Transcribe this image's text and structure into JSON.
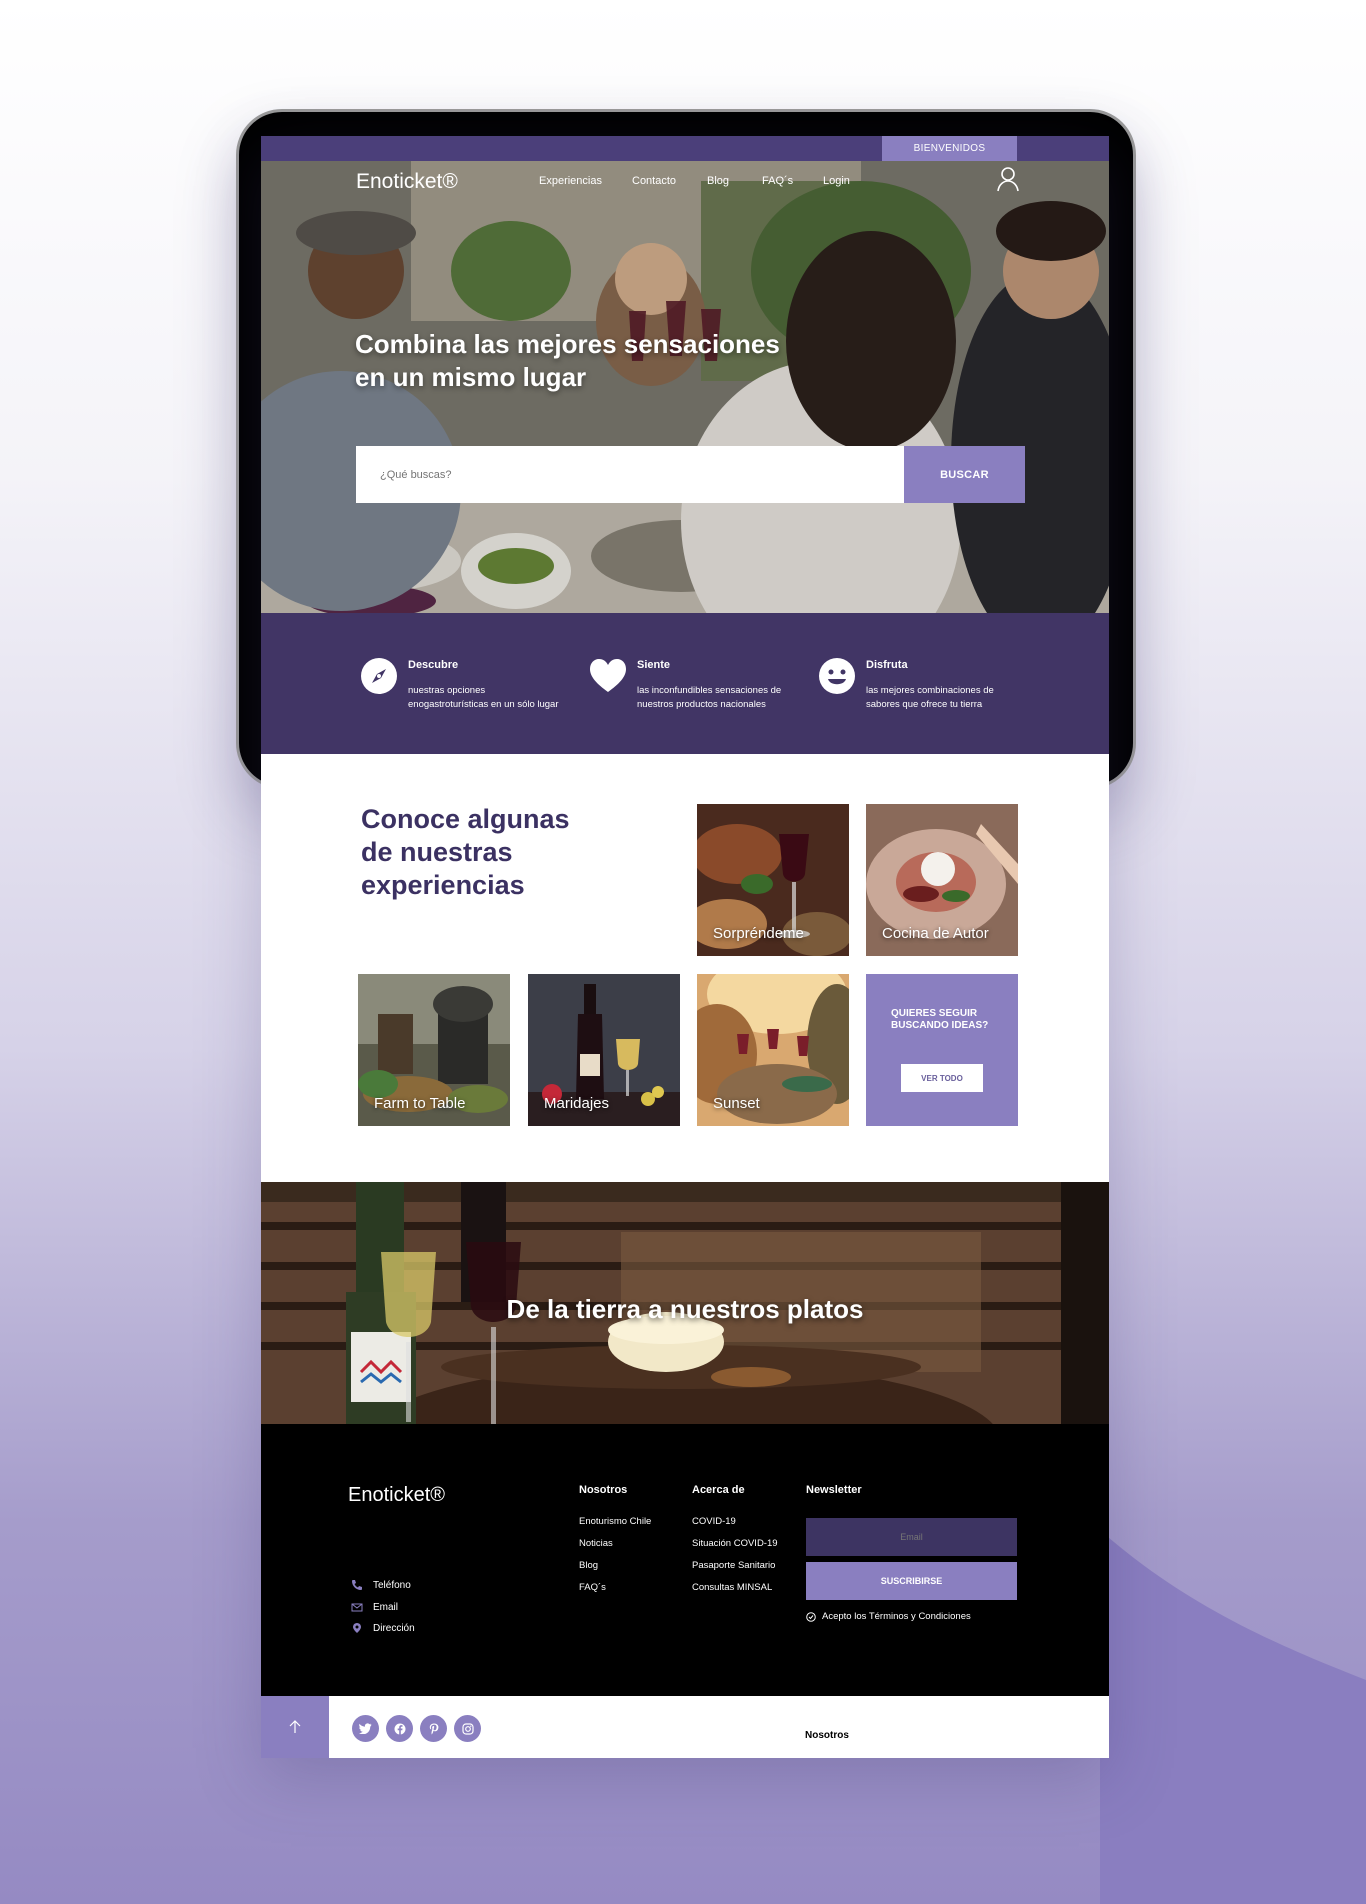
{
  "colors": {
    "primary": "#4b3f7a",
    "accent": "#8a7fc0",
    "dark_purple": "#413565",
    "footer_bg": "#000000"
  },
  "topbar": {
    "welcome_label": "BIENVENIDOS"
  },
  "header": {
    "logo": "Enoticket®",
    "nav": [
      "Experiencias",
      "Contacto",
      "Blog",
      "FAQ´s",
      "Login"
    ],
    "user_icon": "user-icon"
  },
  "hero": {
    "title_line1": "Combina las mejores sensaciones",
    "title_line2": "en un mismo lugar",
    "search_placeholder": "¿Qué buscas?",
    "search_button": "BUSCAR"
  },
  "features": [
    {
      "icon": "compass-icon",
      "title": "Descubre",
      "desc_line1": "nuestras opciones",
      "desc_line2": "enogastroturísticas en un sólo lugar"
    },
    {
      "icon": "heart-icon",
      "title": "Siente",
      "desc_line1": "las inconfundibles sensaciones de",
      "desc_line2": "nuestros productos nacionales"
    },
    {
      "icon": "smile-icon",
      "title": "Disfruta",
      "desc_line1": "las mejores combinaciones de",
      "desc_line2": "sabores que ofrece tu tierra"
    }
  ],
  "experiences": {
    "title_line1": "Conoce algunas",
    "title_line2": "de nuestras",
    "title_line3": "experiencias",
    "cards": [
      "Sorpréndeme",
      "Cocina de Autor",
      "Farm to Table",
      "Maridajes",
      "Sunset"
    ],
    "more_text_line1": "QUIERES SEGUIR",
    "more_text_line2": "BUSCANDO IDEAS?",
    "more_button": "VER TODO"
  },
  "banner": {
    "title": "De la tierra a nuestros platos"
  },
  "footer": {
    "logo": "Enoticket®",
    "contact": [
      "Teléfono",
      "Email",
      "Dirección"
    ],
    "col1_title": "Nosotros",
    "col1_links": [
      "Enoturismo Chile",
      "Noticias",
      "Blog",
      "FAQ´s"
    ],
    "col2_title": "Acerca de",
    "col2_links": [
      "COVID-19",
      "Situación COVID-19",
      "Pasaporte Sanitario",
      "Consultas MINSAL"
    ],
    "newsletter_title": "Newsletter",
    "email_placeholder": "Email",
    "subscribe_button": "SUSCRIBIRSE",
    "terms_label": "Acepto los Términos y Condiciones"
  },
  "bottombar": {
    "social": [
      "twitter-icon",
      "facebook-icon",
      "pinterest-icon",
      "instagram-icon"
    ],
    "link": "Nosotros"
  }
}
